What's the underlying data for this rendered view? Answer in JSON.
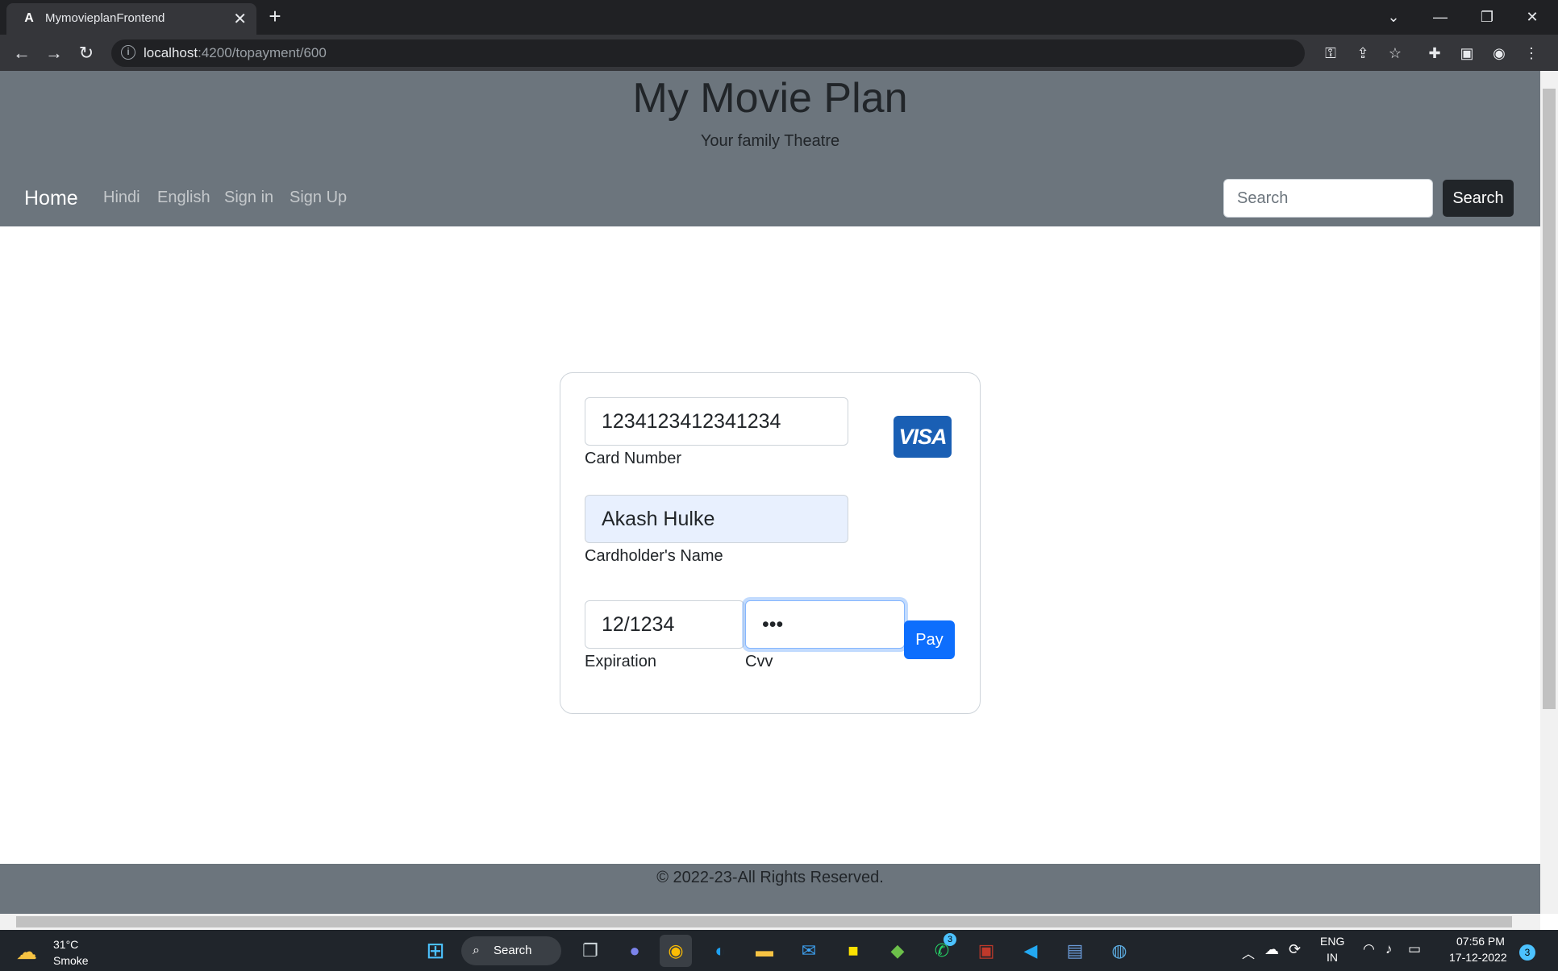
{
  "browser": {
    "tab_title": "MymovieplanFrontend",
    "tab_favicon": "A",
    "url_host": "localhost",
    "url_rest": ":4200/topayment/600"
  },
  "header": {
    "title": "My Movie Plan",
    "subtitle": "Your family Theatre"
  },
  "nav": {
    "home": "Home",
    "links": [
      "Hindi",
      "English",
      "Sign in",
      "Sign Up"
    ]
  },
  "search": {
    "placeholder": "Search",
    "button": "Search"
  },
  "payment": {
    "card_number": "1234123412341234",
    "card_number_label": "Card Number",
    "card_brand": "VISA",
    "cardholder_name": "Akash Hulke",
    "cardholder_label": "Cardholder's Name",
    "expiration": "12/1234",
    "expiration_label": "Expiration",
    "cvv": "•••",
    "cvv_label": "Cvv",
    "pay_button": "Pay"
  },
  "footer": {
    "text": "© 2022-23-All Rights Reserved."
  },
  "taskbar": {
    "weather_temp": "31°C",
    "weather_condition": "Smoke",
    "search_label": "Search",
    "whatsapp_badge": "3",
    "lang_top": "ENG",
    "lang_bottom": "IN",
    "time": "07:56 PM",
    "date": "17-12-2022",
    "notification_count": "3"
  },
  "colors": {
    "header_bg": "#6c757d",
    "primary": "#0d6efd",
    "dark": "#212529"
  }
}
